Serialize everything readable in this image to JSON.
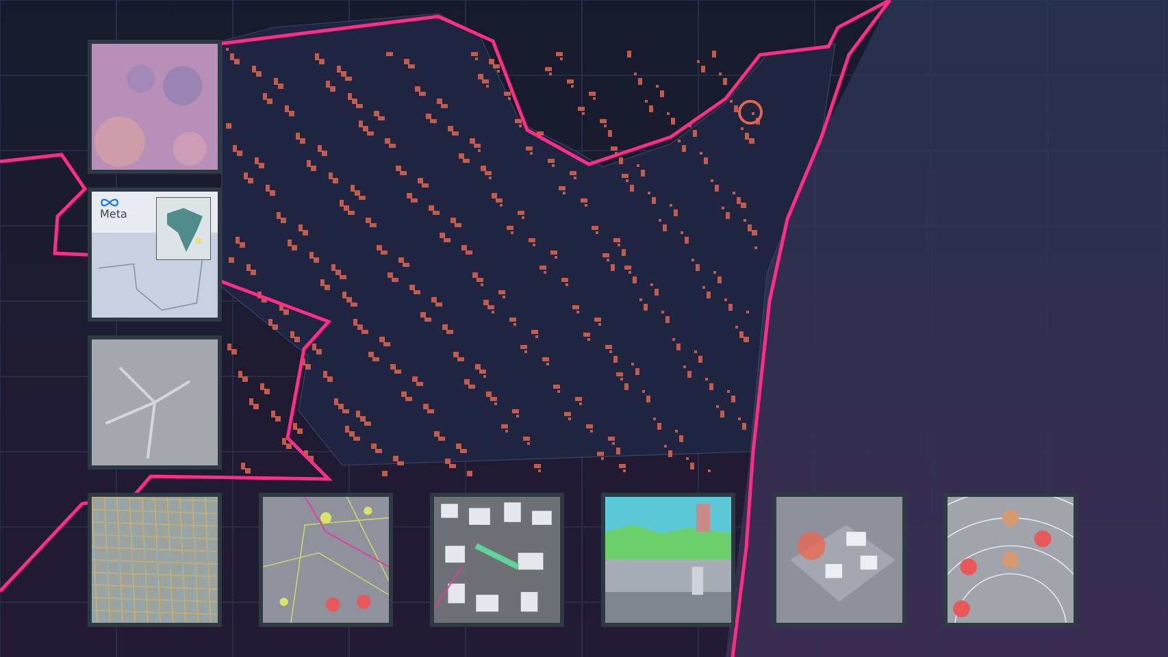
{
  "side_thumbnails": [
    {
      "kind": "heatmap"
    },
    {
      "kind": "logo-map",
      "logo_text": "Meta"
    },
    {
      "kind": "grey-texture"
    }
  ],
  "bottom_thumbnails": [
    {
      "kind": "street-grid"
    },
    {
      "kind": "poi-map"
    },
    {
      "kind": "buildings"
    },
    {
      "kind": "street-view"
    },
    {
      "kind": "hotspots-3d"
    },
    {
      "kind": "rings"
    }
  ]
}
